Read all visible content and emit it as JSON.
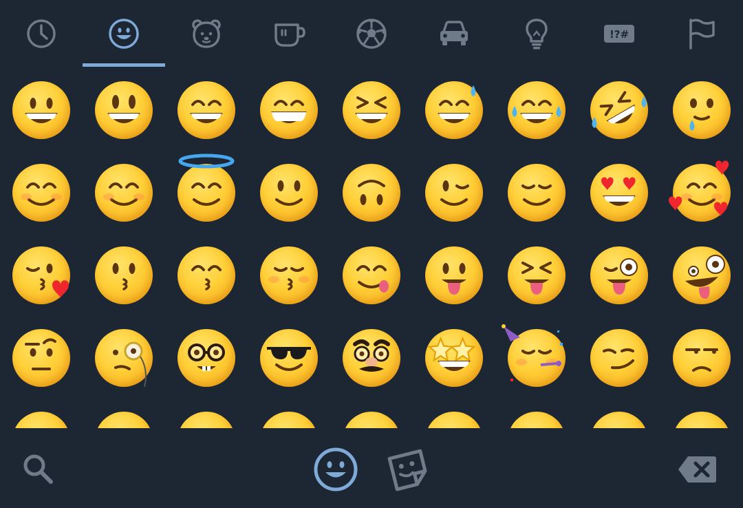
{
  "categories": [
    {
      "name": "recent-tab",
      "icon": "clock-icon",
      "active": false
    },
    {
      "name": "smileys-tab",
      "icon": "smiley-icon",
      "active": true
    },
    {
      "name": "animals-tab",
      "icon": "bear-icon",
      "active": false
    },
    {
      "name": "food-tab",
      "icon": "cup-icon",
      "active": false
    },
    {
      "name": "activity-tab",
      "icon": "soccer-ball-icon",
      "active": false
    },
    {
      "name": "travel-tab",
      "icon": "car-icon",
      "active": false
    },
    {
      "name": "objects-tab",
      "icon": "lightbulb-icon",
      "active": false
    },
    {
      "name": "symbols-tab",
      "icon": "symbols-icon",
      "active": false,
      "label": "!?#"
    },
    {
      "name": "flags-tab",
      "icon": "flag-icon",
      "active": false
    }
  ],
  "emojis": [
    [
      "grinning-face",
      "grinning-face-big-eyes",
      "grinning-face-smiling-eyes",
      "beaming-face",
      "squinting-face",
      "grinning-face-sweat",
      "tears-of-joy",
      "rolling-on-floor-laughing",
      "holding-back-tears"
    ],
    [
      "smiling-face",
      "smiling-face-smiling-eyes",
      "smiling-face-halo",
      "slightly-smiling-face",
      "upside-down-face",
      "winking-face",
      "relieved-face",
      "heart-eyes",
      "smiling-face-hearts"
    ],
    [
      "face-blowing-kiss",
      "kissing-face",
      "kissing-face-smiling-eyes",
      "kissing-face-closed-eyes",
      "face-savoring-food",
      "face-with-tongue",
      "squinting-face-tongue",
      "winking-face-tongue",
      "zany-face"
    ],
    [
      "face-raised-eyebrow",
      "face-with-monocle",
      "nerd-face",
      "smiling-face-sunglasses",
      "disguised-face",
      "star-struck",
      "partying-face",
      "smirking-face",
      "unamused-face"
    ],
    [
      "partial-1",
      "partial-2",
      "partial-3",
      "partial-4",
      "partial-5",
      "partial-6",
      "partial-7",
      "partial-8",
      "partial-9"
    ]
  ],
  "bottom_bar": {
    "search_icon": "search-icon",
    "emoji_mode_icon": "smiley-icon",
    "sticker_mode_icon": "sticker-icon",
    "backspace_icon": "backspace-icon"
  },
  "colors": {
    "background": "#1d2733",
    "icon_inactive": "#6f7b88",
    "accent": "#7fa9d6",
    "emoji_yellow": "#ffcf37"
  }
}
